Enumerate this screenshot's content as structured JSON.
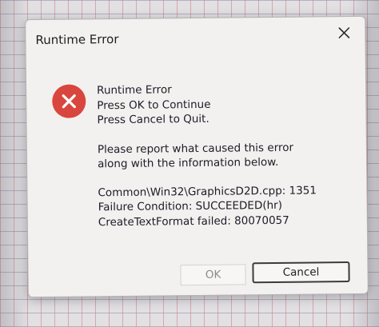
{
  "dialog": {
    "title": "Runtime Error",
    "close_icon": "close-icon",
    "error_icon": "error-icon",
    "error_icon_color": "#d9463e",
    "message": {
      "line1": "Runtime Error",
      "line2": "Press OK to Continue",
      "line3": "Press Cancel to Quit.",
      "line4": "Please report what caused this error",
      "line5": "along with the information below.",
      "line6": "Common\\Win32\\GraphicsD2D.cpp: 1351",
      "line7": "Failure Condition: SUCCEEDED(hr)",
      "line8": "CreateTextFormat failed: 80070057"
    },
    "buttons": {
      "ok_label": "OK",
      "cancel_label": "Cancel"
    }
  }
}
